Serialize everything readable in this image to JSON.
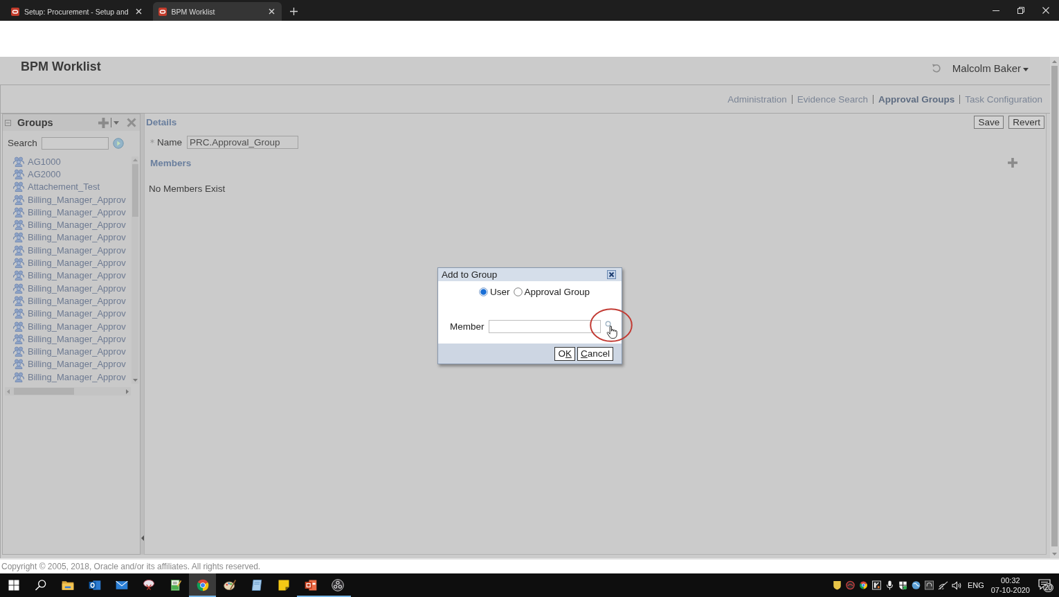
{
  "browser": {
    "tabs": [
      {
        "title": "Setup: Procurement - Setup and",
        "selected": false
      },
      {
        "title": "BPM Worklist",
        "selected": true
      }
    ]
  },
  "header": {
    "title": "BPM Worklist",
    "user": "Malcolm Baker"
  },
  "nav_links": [
    {
      "label": "Administration",
      "selected": false
    },
    {
      "label": "Evidence Search",
      "selected": false
    },
    {
      "label": "Approval Groups",
      "selected": true
    },
    {
      "label": "Task Configuration",
      "selected": false
    }
  ],
  "groups_panel": {
    "title": "Groups",
    "search_label": "Search",
    "items": [
      {
        "label": "AG1000"
      },
      {
        "label": "AG2000"
      },
      {
        "label": "Attachement_Test"
      },
      {
        "label": "Billing_Manager_Approv"
      },
      {
        "label": "Billing_Manager_Approv"
      },
      {
        "label": "Billing_Manager_Approv"
      },
      {
        "label": "Billing_Manager_Approv"
      },
      {
        "label": "Billing_Manager_Approv"
      },
      {
        "label": "Billing_Manager_Approv"
      },
      {
        "label": "Billing_Manager_Approv"
      },
      {
        "label": "Billing_Manager_Approv"
      },
      {
        "label": "Billing_Manager_Approv"
      },
      {
        "label": "Billing_Manager_Approv"
      },
      {
        "label": "Billing_Manager_Approv"
      },
      {
        "label": "Billing_Manager_Approv"
      },
      {
        "label": "Billing_Manager_Approv"
      },
      {
        "label": "Billing_Manager_Approv"
      },
      {
        "label": "Billing_Manager_Approv"
      }
    ]
  },
  "details": {
    "title": "Details",
    "buttons": [
      "Save",
      "Revert"
    ],
    "name_field": {
      "label": "Name",
      "required": true,
      "value": "PRC.Approval_Group"
    },
    "members_title": "Members",
    "empty_message": "No Members Exist"
  },
  "dialog": {
    "title": "Add to Group",
    "options": [
      {
        "label": "User",
        "selected": true
      },
      {
        "label": "Approval Group",
        "selected": false
      }
    ],
    "member_field": {
      "label": "Member"
    },
    "buttons": [
      {
        "text_before": "O",
        "access_key": "K"
      },
      {
        "access_key": "C",
        "text_after": "ancel"
      }
    ]
  },
  "footer": {
    "copyright": "Copyright © 2005, 2018, Oracle and/or its affiliates. All rights reserved."
  },
  "taskbar": {
    "apps": [
      {
        "kind": "start",
        "running": false,
        "selected": false
      },
      {
        "kind": "search",
        "running": false,
        "selected": false
      },
      {
        "kind": "folder",
        "running": false,
        "selected": false
      },
      {
        "kind": "outlook",
        "running": false,
        "selected": false
      },
      {
        "kind": "mail",
        "running": false,
        "selected": false
      },
      {
        "kind": "snip",
        "running": false,
        "selected": false
      },
      {
        "kind": "notepad",
        "running": false,
        "selected": false
      },
      {
        "kind": "chrome",
        "running": true,
        "selected": true
      },
      {
        "kind": "paint",
        "running": false,
        "selected": false
      },
      {
        "kind": "journal",
        "running": false,
        "selected": false
      },
      {
        "kind": "sticky",
        "running": false,
        "selected": false
      },
      {
        "kind": "slides",
        "running": true,
        "selected": false
      },
      {
        "kind": "recorder",
        "running": true,
        "selected": false
      }
    ],
    "tray": {
      "language": "ENG",
      "time": "00:32",
      "date": "07-10-2020",
      "notifications": "20"
    }
  }
}
